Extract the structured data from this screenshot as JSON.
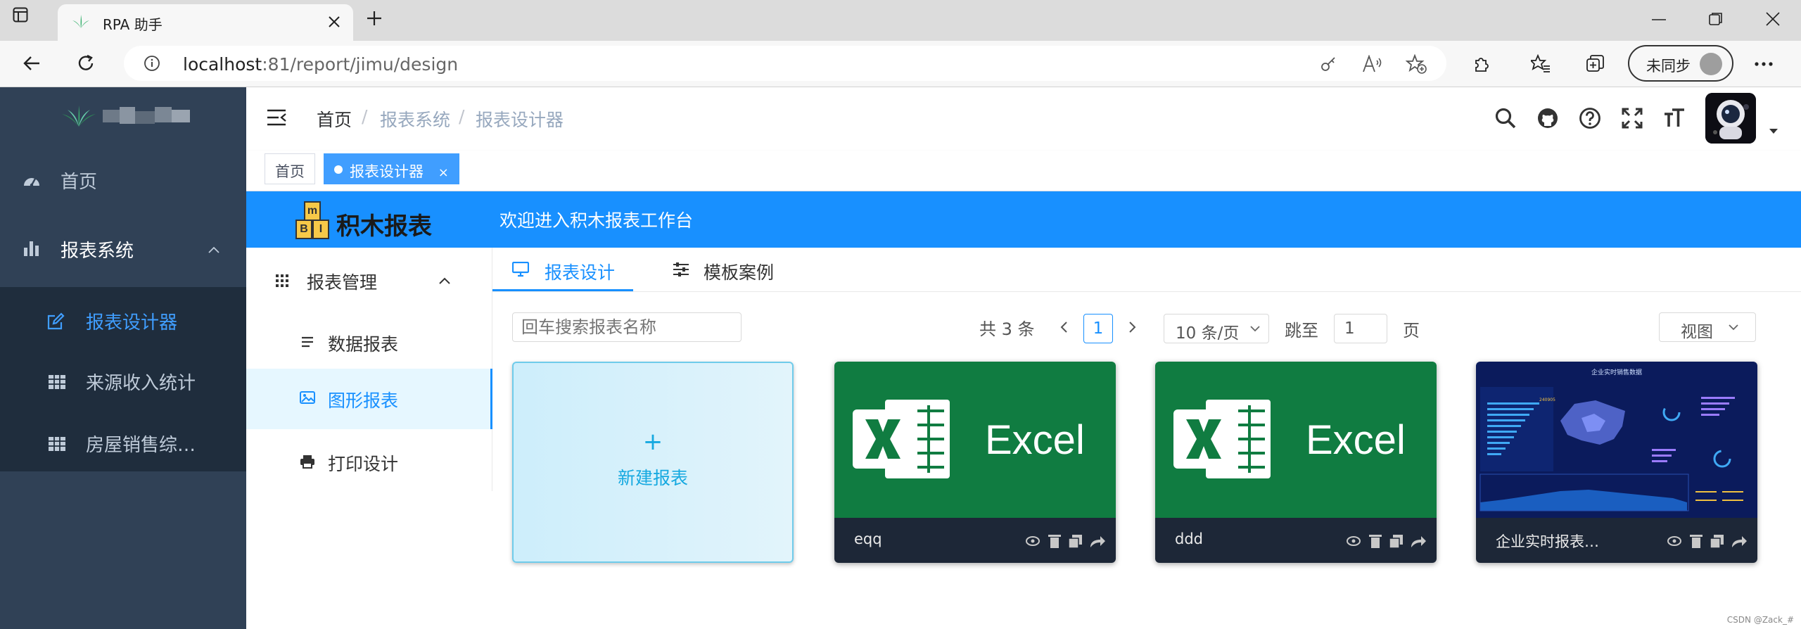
{
  "browser": {
    "tab_title": "RPA 助手",
    "url_host": "localhost",
    "url_path": ":81/report/jimu/design",
    "sync_label": "未同步"
  },
  "sidebar": {
    "items": [
      {
        "label": "首页"
      },
      {
        "label": "报表系统"
      }
    ],
    "sub_items": [
      {
        "label": "报表设计器"
      },
      {
        "label": "来源收入统计"
      },
      {
        "label": "房屋销售综…"
      }
    ],
    "active_color": "#409eff"
  },
  "header": {
    "breadcrumb": [
      "首页",
      "报表系统",
      "报表设计器"
    ],
    "separator": "/"
  },
  "tags": [
    {
      "label": "首页"
    },
    {
      "label": "报表设计器",
      "close": "×"
    }
  ],
  "jimu": {
    "logo_text": "积木报表",
    "logo_blocks": [
      "m",
      "B",
      "I"
    ],
    "welcome": "欢迎进入积木报表工作台",
    "header_color": "#1890ff",
    "menu": {
      "title": "报表管理",
      "items": [
        {
          "label": "数据报表"
        },
        {
          "label": "图形报表"
        },
        {
          "label": "打印设计"
        }
      ]
    },
    "tabs": [
      {
        "label": "报表设计"
      },
      {
        "label": "模板案例"
      }
    ],
    "search_placeholder": "回车搜索报表名称",
    "pagination": {
      "total": "共 3 条",
      "current_page": "1",
      "page_size": "10 条/页",
      "goto_label": "跳至",
      "goto_value": "1",
      "page_suffix": "页"
    },
    "view_label": "视图",
    "new_card": {
      "plus": "+",
      "label": "新建报表"
    },
    "cards": [
      {
        "name": "eqq",
        "thumb": "Excel"
      },
      {
        "name": "ddd",
        "thumb": "Excel"
      },
      {
        "name": "企业实时报表…",
        "thumb_title": "企业实时销售数据"
      }
    ]
  },
  "watermark": "CSDN @Zack_#"
}
